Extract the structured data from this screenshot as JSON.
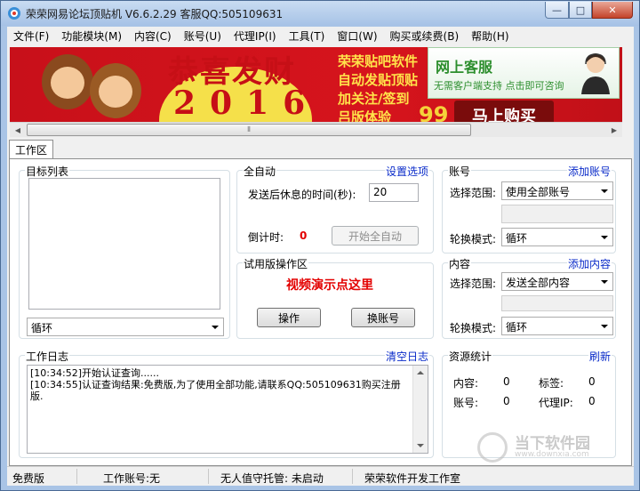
{
  "window": {
    "title": "荣荣网易论坛顶贴机 V6.6.2.29  客服QQ:505109631",
    "min_glyph": "—",
    "max_glyph": "□",
    "close_glyph": "✕"
  },
  "menu": [
    "文件(F)",
    "功能模块(M)",
    "内容(C)",
    "账号(U)",
    "代理IP(I)",
    "工具(T)",
    "窗口(W)",
    "购买或续费(B)",
    "帮助(H)"
  ],
  "banner": {
    "greeting": "恭喜发财",
    "year": "2016",
    "promo_lines": [
      "荣荣贴吧软件",
      "自动发贴顶贴",
      "加关注/签到",
      "吕版体验"
    ],
    "price": "99",
    "buy_label": "马上购买",
    "service_title": "网上客服",
    "service_sub": "无需客户端支持  点击即可咨询"
  },
  "tabs": [
    "工作区"
  ],
  "target_list": {
    "title": "目标列表",
    "mode_value": "循环"
  },
  "auto": {
    "title": "全自动",
    "settings_link": "设置选项",
    "rest_label": "发送后休息的时间(秒):",
    "rest_value": "20",
    "countdown_label": "倒计时:",
    "countdown_value": "0",
    "start_button": "开始全自动"
  },
  "trial": {
    "title": "试用版操作区",
    "demo_link": "视频演示点这里",
    "operate_button": "操作",
    "switch_button": "换账号"
  },
  "account": {
    "title": "账号",
    "add_link": "添加账号",
    "scope_label": "选择范围:",
    "scope_value": "使用全部账号",
    "rotate_label": "轮换模式:",
    "rotate_value": "循环"
  },
  "content": {
    "title": "内容",
    "add_link": "添加内容",
    "scope_label": "选择范围:",
    "scope_value": "发送全部内容",
    "rotate_label": "轮换模式:",
    "rotate_value": "循环"
  },
  "worklog": {
    "title": "工作日志",
    "clear_link": "清空日志",
    "lines": [
      "[10:34:52]开始认证查询......",
      "[10:34:55]认证查询结果:免费版,为了使用全部功能,请联系QQ:505109631购买注册版."
    ]
  },
  "stats": {
    "title": "资源统计",
    "refresh_link": "刷新",
    "content_label": "内容:",
    "content_value": "0",
    "tag_label": "标签:",
    "tag_value": "0",
    "account_label": "账号:",
    "account_value": "0",
    "proxy_label": "代理IP:",
    "proxy_value": "0"
  },
  "status": {
    "edition": "免费版",
    "work_account": "工作账号:无",
    "unattended": "无人值守托管: 未启动",
    "studio": "荣荣软件开发工作室"
  },
  "watermark": {
    "name": "当下软件园",
    "url": "www.downxia.com"
  },
  "colors": {
    "link": "#0a2bc9",
    "alert": "#e30000",
    "banner_red": "#c8101a",
    "service_green": "#2c8e2d"
  }
}
